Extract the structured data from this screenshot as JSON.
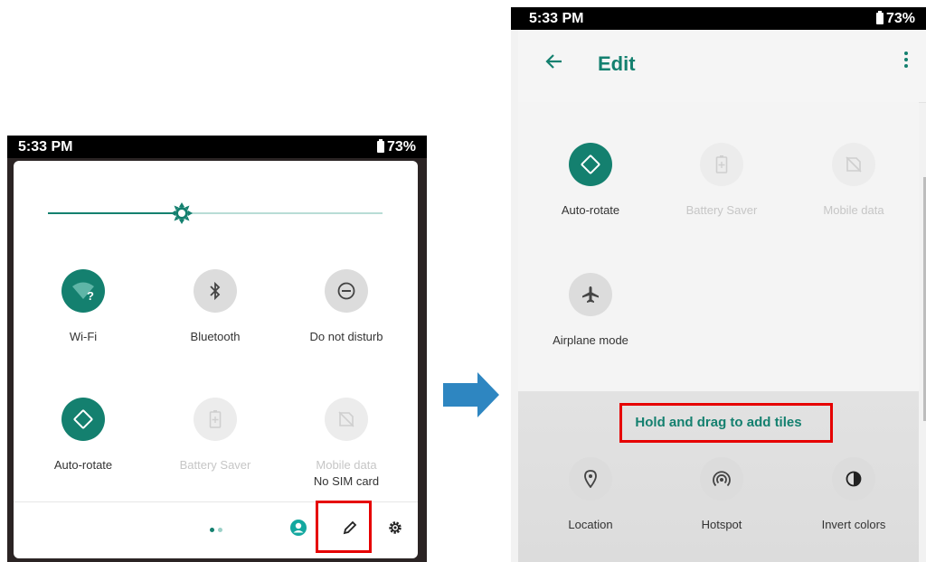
{
  "left_phone": {
    "status": {
      "time": "5:33 PM",
      "battery": "73%"
    },
    "brightness_level": 0.4,
    "tiles": [
      {
        "label": "Wi-Fi",
        "icon": "wifi-question-icon",
        "state": "on"
      },
      {
        "label": "Bluetooth",
        "icon": "bluetooth-icon",
        "state": "off"
      },
      {
        "label": "Do not disturb",
        "icon": "do-not-disturb-icon",
        "state": "off"
      },
      {
        "label": "Auto-rotate",
        "icon": "auto-rotate-icon",
        "state": "on"
      },
      {
        "label": "Battery Saver",
        "icon": "battery-saver-icon",
        "state": "unavailable"
      },
      {
        "label": "Mobile data",
        "sublabel": "No SIM card",
        "icon": "mobile-data-off-icon",
        "state": "unavailable"
      }
    ],
    "footer": {
      "page_count": 2,
      "active_page": 1,
      "buttons": [
        "user-icon",
        "edit-pencil-icon",
        "settings-gear-icon"
      ]
    }
  },
  "right_phone": {
    "status": {
      "time": "5:33 PM",
      "battery": "73%"
    },
    "appbar": {
      "title": "Edit",
      "back_icon": "back-arrow-icon",
      "menu_icon": "overflow-menu-icon"
    },
    "current_tiles": [
      {
        "label": "Auto-rotate",
        "icon": "auto-rotate-icon",
        "state": "on"
      },
      {
        "label": "Battery Saver",
        "icon": "battery-saver-icon",
        "state": "unavailable"
      },
      {
        "label": "Mobile data",
        "icon": "mobile-data-off-icon",
        "state": "unavailable"
      },
      {
        "label": "Airplane mode",
        "icon": "airplane-icon",
        "state": "off"
      }
    ],
    "hint": "Hold and drag to add tiles",
    "available_tiles": [
      {
        "label": "Location",
        "icon": "location-pin-icon"
      },
      {
        "label": "Hotspot",
        "icon": "hotspot-icon"
      },
      {
        "label": "Invert colors",
        "icon": "invert-colors-icon"
      }
    ]
  },
  "colors": {
    "accent": "#14806f",
    "highlight": "#e60000",
    "arrow": "#2e86c1"
  }
}
